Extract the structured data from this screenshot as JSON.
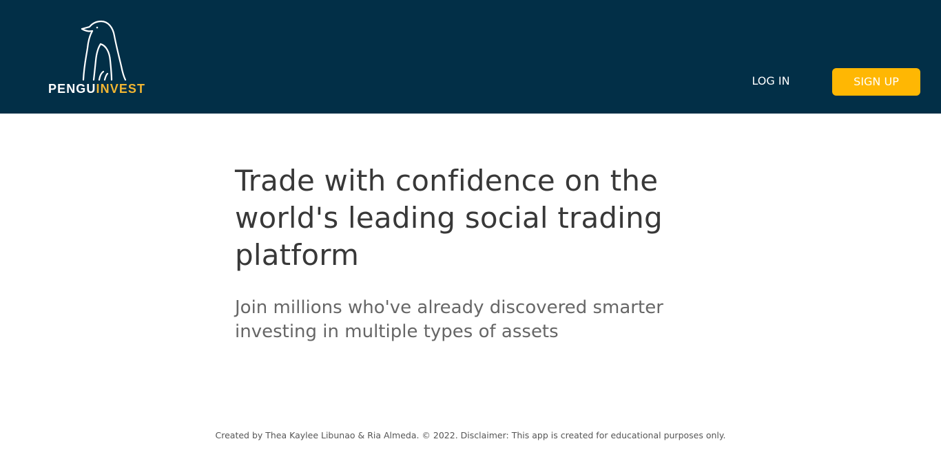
{
  "header": {
    "logo": {
      "icon": "penguin-icon",
      "brand_part1": "PENGU",
      "brand_part2": "INVEST"
    },
    "nav": {
      "login_label": "LOG IN",
      "signup_label": "SIGN UP"
    }
  },
  "hero": {
    "title": "Trade with confidence on the world's leading social trading platform",
    "subtitle": "Join millions who've already discovered smarter investing in multiple types of assets"
  },
  "footer": {
    "text": "Created by Thea Kaylee Libunao & Ria Almeda. © 2022. Disclaimer: This app is created for educational purposes only."
  },
  "colors": {
    "header_bg": "#022f47",
    "accent": "#ffb703",
    "brand_accent": "#f2b632",
    "title_text": "#383838",
    "subtitle_text": "#666666"
  }
}
